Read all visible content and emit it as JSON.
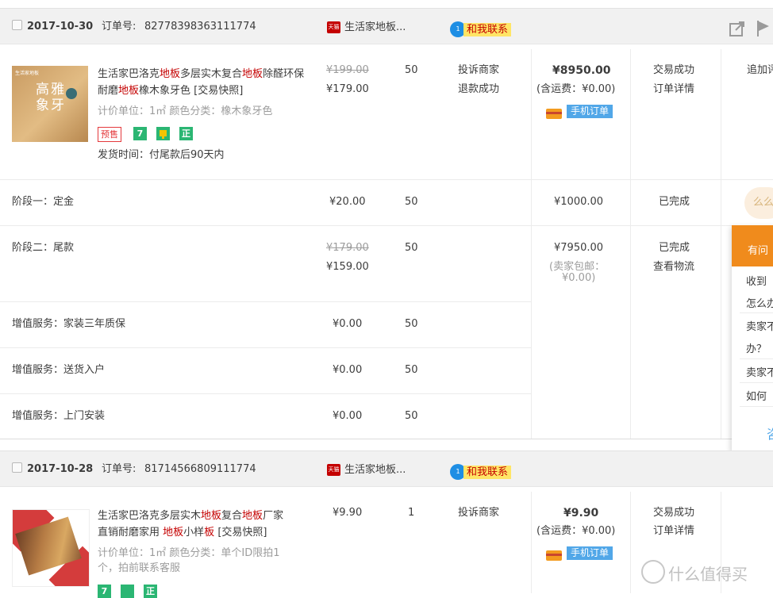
{
  "orders": [
    {
      "date": "2017-10-30",
      "order_no_label": "订单号:",
      "order_no": "82778398363111774",
      "shop_name": "生活家地板...",
      "shop_badge": "天猫",
      "contact_label": "和我联系",
      "item": {
        "title_parts": [
          "生活家巴洛克",
          "地板",
          "多层实木复合",
          "地板",
          "除醛",
          "环保耐磨",
          "地板",
          "橡木象牙色 [交易快照]"
        ],
        "attrs": "计价单位：1㎡  颜色分类：橡木象牙色",
        "presale_tag": "预售",
        "shipping": "发货时间：付尾款后90天内",
        "original_price": "¥199.00",
        "price": "¥179.00",
        "qty": "50",
        "after_sale_1": "投诉商家",
        "after_sale_2": "退款成功",
        "total": "¥8950.00",
        "shipping_fee": "(含运费：¥0.00)",
        "mobile_label": "手机订单",
        "status_1": "交易成功",
        "status_2": "订单详情",
        "op": "追加评"
      },
      "stages": [
        {
          "label": "阶段一：定金",
          "price": "¥20.00",
          "qty": "50",
          "total": "¥1000.00",
          "status": "已完成"
        },
        {
          "label": "阶段二：尾款",
          "original_price": "¥179.00",
          "price": "¥159.00",
          "qty": "50",
          "total": "¥7950.00",
          "total_note_1": "(卖家包邮：",
          "total_note_2": "¥0.00)",
          "status_1": "已完成",
          "status_2": "查看物流"
        }
      ],
      "services": [
        {
          "label": "增值服务：家装三年质保",
          "price": "¥0.00",
          "qty": "50"
        },
        {
          "label": "增值服务：送货入户",
          "price": "¥0.00",
          "qty": "50"
        },
        {
          "label": "增值服务：上门安装",
          "price": "¥0.00",
          "qty": "50"
        }
      ]
    },
    {
      "date": "2017-10-28",
      "order_no_label": "订单号:",
      "order_no": "81714566809111774",
      "shop_name": "生活家地板...",
      "shop_badge": "天猫",
      "contact_label": "和我联系",
      "item": {
        "title_line1_parts": [
          "生活家巴洛克多层实木",
          "地板",
          "复合",
          "地板",
          "厂家"
        ],
        "title_line2_parts": [
          "直销耐磨家用 ",
          "地板",
          "小样",
          "板",
          " [交易快照]"
        ],
        "attrs_1": "计价单位：1㎡  颜色分类：单个ID限拍1",
        "attrs_2": "个，拍前联系客服",
        "price": "¥9.90",
        "qty": "1",
        "after_sale_1": "投诉商家",
        "total": "¥9.90",
        "shipping_fee": "(含运费：¥0.00)",
        "mobile_label": "手机订单",
        "status_1": "交易成功",
        "status_2": "订单详情"
      }
    }
  ],
  "thumb1_text": "高雅象牙",
  "side_bubble": "么么",
  "chat": {
    "header": "有问",
    "q1a": "收到",
    "q1b": "怎么办",
    "q2a": "卖家不",
    "q2b": "办？",
    "q3": "卖家不",
    "q4": "如何",
    "more": "咨"
  },
  "watermark": "什么值得买",
  "colors": {
    "red": "#c40000",
    "tmall": "#c40000",
    "contact_bg": "#ffe566",
    "mobile": "#51a7e8",
    "orange": "#f08b1c"
  }
}
